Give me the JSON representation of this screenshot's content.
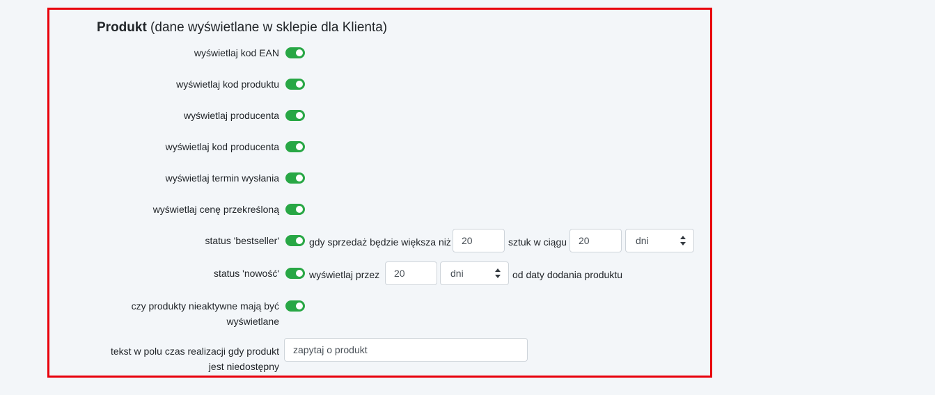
{
  "section": {
    "title_bold": "Produkt",
    "title_rest": " (dane wyświetlane w sklepie dla Klienta)"
  },
  "toggles": [
    {
      "label": "wyświetlaj kod EAN",
      "on": true
    },
    {
      "label": "wyświetlaj kod produktu",
      "on": true
    },
    {
      "label": "wyświetlaj producenta",
      "on": true
    },
    {
      "label": "wyświetlaj kod producenta",
      "on": true
    },
    {
      "label": "wyświetlaj termin wysłania",
      "on": true
    },
    {
      "label": "wyświetlaj cenę przekreśloną",
      "on": true
    }
  ],
  "bestseller": {
    "label": "status 'bestseller'",
    "on": true,
    "text_before": "gdy sprzedaż będzie większa niż",
    "quantity_value": "20",
    "text_middle": "sztuk w ciągu",
    "period_value": "20",
    "unit_selected": "dni"
  },
  "new_status": {
    "label": "status 'nowość'",
    "on": true,
    "text_before": "wyświetlaj przez",
    "period_value": "20",
    "unit_selected": "dni",
    "text_after": "od daty dodania produktu"
  },
  "inactive": {
    "label": "czy produkty nieaktywne mają być wyświetlane",
    "on": true
  },
  "unavailable_text": {
    "label": "tekst w polu czas realizacji gdy produkt jest niedostępny",
    "value": "zapytaj o produkt"
  },
  "colors": {
    "frame_border": "#e8000b",
    "toggle_on": "#28a745",
    "background": "#f3f6f9"
  }
}
